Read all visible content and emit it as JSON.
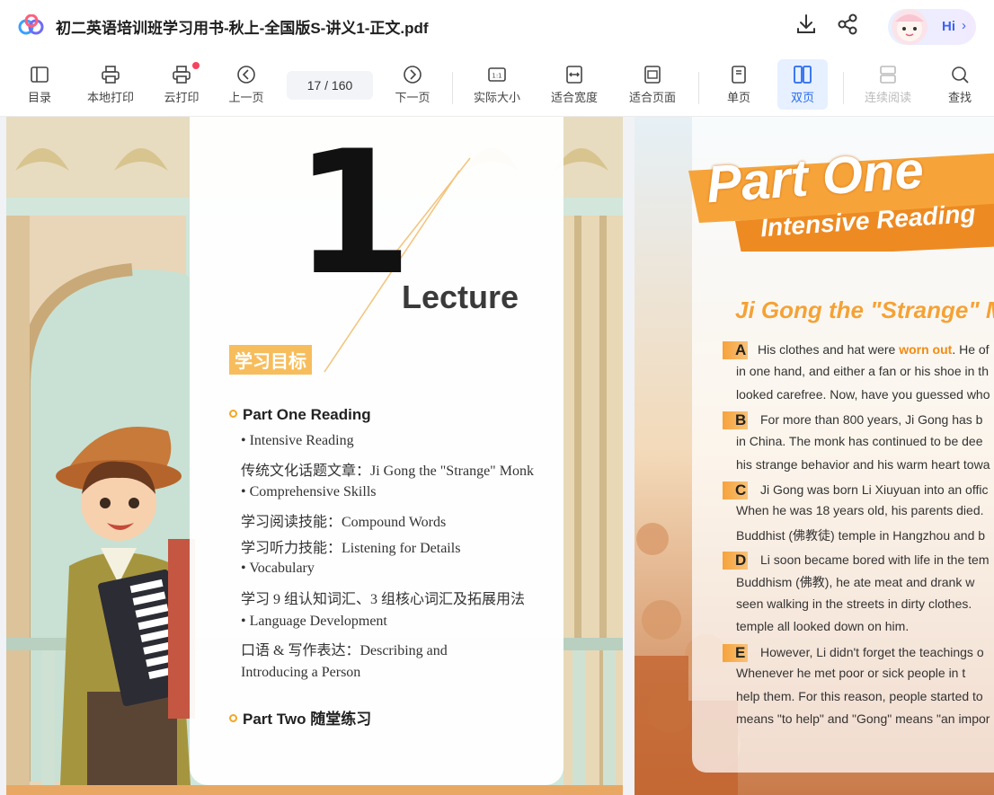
{
  "app": {
    "title": "初二英语培训班学习用书-秋上-全国版S-讲义1-正文.pdf",
    "assistant_label": "Hi"
  },
  "toolbar": {
    "items": [
      {
        "label": "目录",
        "icon": "toc-icon"
      },
      {
        "label": "本地打印",
        "icon": "printer-icon"
      },
      {
        "label": "云打印",
        "icon": "cloud-print-icon"
      },
      {
        "label": "上一页",
        "icon": "prev-page-icon"
      },
      {
        "label": "下一页",
        "icon": "next-page-icon"
      },
      {
        "label": "实际大小",
        "icon": "actual-size-icon"
      },
      {
        "label": "适合宽度",
        "icon": "fit-width-icon"
      },
      {
        "label": "适合页面",
        "icon": "fit-page-icon"
      },
      {
        "label": "单页",
        "icon": "single-page-icon"
      },
      {
        "label": "双页",
        "icon": "double-page-icon"
      },
      {
        "label": "连续阅读",
        "icon": "continuous-icon"
      },
      {
        "label": "查找",
        "icon": "search-icon"
      }
    ],
    "page_current": "17",
    "page_total": "/ 160"
  },
  "left_page": {
    "number": "1",
    "lecture": "Lecture",
    "goal_tag": "学习目标",
    "part_one": "Part One  Reading",
    "lines": [
      "• Intensive Reading",
      "传统文化话题文章：Ji Gong the \"Strange\" Monk",
      "• Comprehensive Skills",
      "学习阅读技能：Compound Words",
      "学习听力技能：Listening for Details",
      "• Vocabulary",
      "学习 9 组认知词汇、3 组核心词汇及拓展用法",
      "• Language Development",
      "口语 & 写作表达：Describing and",
      "Introducing a Person"
    ],
    "part_two": "Part Two  随堂练习"
  },
  "right_page": {
    "banner_main": "Part One",
    "banner_sub": "Intensive Reading",
    "article_title": "Ji Gong the \"Strange\" M",
    "paragraphs": [
      {
        "letter": "A",
        "lines": [
          "His clothes and hat were",
          "worn out",
          ". He of",
          "in one hand, and either a fan or his shoe in th",
          "looked carefree. Now, have you guessed who"
        ]
      },
      {
        "letter": "B",
        "lines": [
          "For more than 800 years, Ji Gong has b",
          "in China. The monk has continued to be dee",
          "his strange behavior and his warm heart towa"
        ]
      },
      {
        "letter": "C",
        "lines": [
          "Ji Gong was born Li Xiuyuan into an offic",
          "When he was 18 years old, his parents died. ",
          "Buddhist (佛教徒) temple in Hangzhou and b"
        ]
      },
      {
        "letter": "D",
        "lines": [
          "Li soon became bored with life in the tem",
          "Buddhism (佛教), he ate meat and drank w",
          "seen walking in the streets in dirty clothes. ",
          "temple all looked down on him."
        ]
      },
      {
        "letter": "E",
        "lines": [
          "However, Li didn't forget the teachings o",
          "Whenever he met poor or sick people in t",
          "help them. For this reason, people started to",
          "means \"to help\" and \"Gong\" means \"an impor"
        ]
      }
    ]
  },
  "colors": {
    "accent": "#2a6cf0",
    "orange": "#f5a235",
    "red_dot": "#f5445e"
  }
}
